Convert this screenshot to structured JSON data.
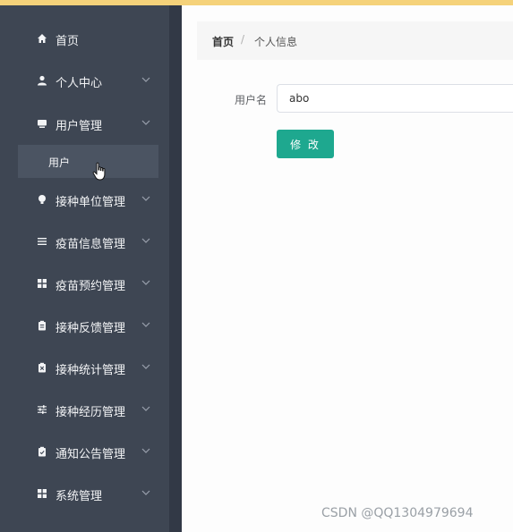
{
  "sidebar": {
    "items": [
      {
        "label": "首页",
        "icon": "home-icon"
      },
      {
        "label": "个人中心",
        "icon": "user-icon"
      },
      {
        "label": "用户管理",
        "icon": "monitor-icon"
      },
      {
        "label": "接种单位管理",
        "icon": "bulb-icon"
      },
      {
        "label": "疫苗信息管理",
        "icon": "list-icon"
      },
      {
        "label": "疫苗预约管理",
        "icon": "grid-icon"
      },
      {
        "label": "接种反馈管理",
        "icon": "clipboard-icon"
      },
      {
        "label": "接种统计管理",
        "icon": "clipboard-x-icon"
      },
      {
        "label": "接种经历管理",
        "icon": "sliders-icon"
      },
      {
        "label": "通知公告管理",
        "icon": "clipboard-check-icon"
      },
      {
        "label": "系统管理",
        "icon": "grid-icon"
      }
    ],
    "submenu": {
      "label": "用户"
    }
  },
  "breadcrumb": {
    "home": "首页",
    "separator": "/",
    "current": "个人信息"
  },
  "form": {
    "username_label": "用户名",
    "username_value": "abo",
    "submit_label": "修 改"
  },
  "watermark": "CSDN @QQ1304979694",
  "colors": {
    "sidebar": "#3e4653",
    "accent_button": "#1ea88f",
    "top_bar": "#f5d27a"
  }
}
